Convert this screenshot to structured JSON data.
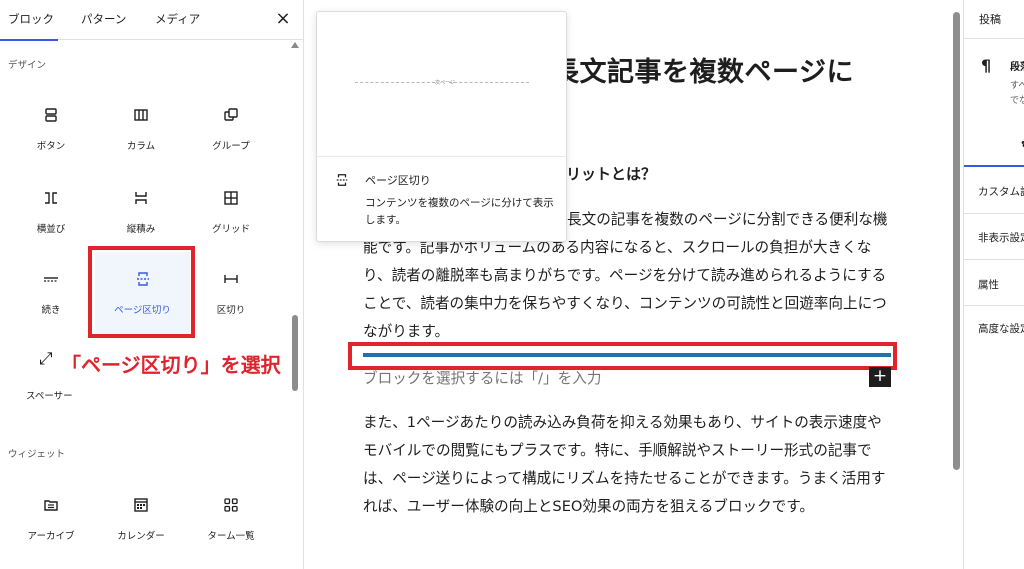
{
  "inserter": {
    "tabs": [
      "ブロック",
      "パターン",
      "メディア"
    ],
    "close_icon": "×",
    "categories": {
      "design": "デザイン",
      "widgets": "ウィジェット"
    },
    "design_blocks": [
      {
        "label": "ボタン",
        "icon": "button-icon"
      },
      {
        "label": "カラム",
        "icon": "columns-icon"
      },
      {
        "label": "グループ",
        "icon": "group-icon"
      },
      {
        "label": "横並び",
        "icon": "row-icon"
      },
      {
        "label": "縦積み",
        "icon": "stack-icon"
      },
      {
        "label": "グリッド",
        "icon": "grid-icon"
      },
      {
        "label": "続き",
        "icon": "more-icon"
      },
      {
        "label": "ページ区切り",
        "icon": "page-break-icon"
      },
      {
        "label": "区切り",
        "icon": "separator-icon"
      },
      {
        "label": "スペーサー",
        "icon": "spacer-icon"
      }
    ],
    "widget_blocks": [
      {
        "label": "アーカイブ",
        "icon": "archive-icon"
      },
      {
        "label": "カレンダー",
        "icon": "calendar-icon"
      },
      {
        "label": "ターム一覧",
        "icon": "term-list-icon"
      }
    ],
    "callout": "「ページ区切り」を選択"
  },
  "preview": {
    "page_label": "次ページ",
    "title": "ページ区切り",
    "description": "コンテンツを複数のページに分けて表示します。"
  },
  "editor": {
    "title_fragment": "長文記事を複数ページに",
    "heading_fragment": "リットとは？",
    "paragraph1": "「ページ区切り」ブロックは、長文の記事を複数のページに分割できる便利な機能です。記事がボリュームのある内容になると、スクロールの負担が大きくなり、読者の離脱率も高まりがちです。ページを分けて読み進められるようにすることで、読者の集中力を保ちやすくなり、コンテンツの可読性と回遊率向上につながります。",
    "placeholder": "ブロックを選択するには「/」を入力",
    "add_block": "+",
    "paragraph2": "また、1ページあたりの読み込み負荷を抑える効果もあり、サイトの表示速度やモバイルでの閲覧にもプラスです。特に、手順解説やストーリー形式の記事では、ページ送りによって構成にリズムを持たせることができます。うまく活用すれば、ユーザー体験の向上とSEO効果の両方を狙えるブロックです。"
  },
  "settings": {
    "tab": "投稿",
    "block_icon": "¶",
    "block_name": "段落",
    "block_desc_1": "すべての物語の",
    "block_desc_2": "でなく、テキス",
    "items": [
      "カスタム設定",
      "非表示設定",
      "属性",
      "高度な設定"
    ]
  },
  "colors": {
    "accent": "#3858e9",
    "highlight": "#e0242d",
    "page_break_line": "#1d72b4"
  }
}
